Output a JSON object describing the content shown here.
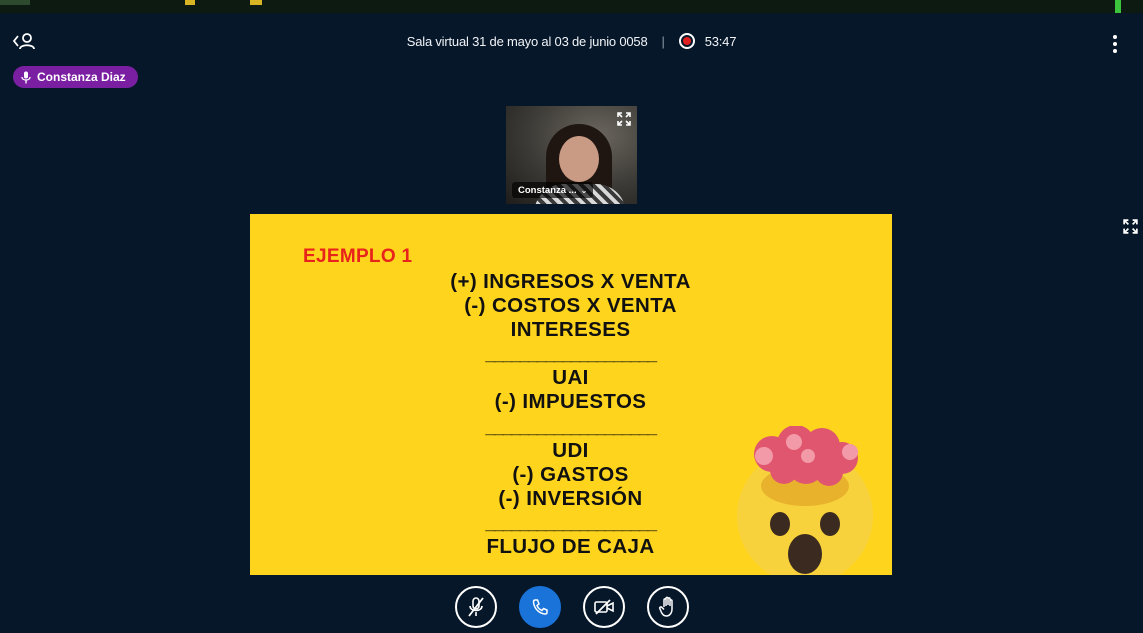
{
  "header": {
    "meeting_title": "Sala virtual 31 de mayo al 03 de junio 0058",
    "separator": "|",
    "recording_time": "53:47"
  },
  "talker": {
    "name": "Constanza Diaz"
  },
  "webcam": {
    "name": "Constanza ..."
  },
  "slide": {
    "title": "EJEMPLO 1",
    "lines": [
      "(+) INGRESOS X VENTA",
      "(-) COSTOS X VENTA",
      "INTERESES",
      "____________________",
      "UAI",
      "(-) IMPUESTOS",
      "____________________",
      "UDI",
      "(-) GASTOS",
      "(-) INVERSIÓN",
      "____________________",
      "FLUJO DE CAJA"
    ]
  },
  "icons": {
    "users": "user-list-icon",
    "record": "record-icon",
    "options": "more-vertical-icon",
    "expand": "expand-icon",
    "mute": "microphone-muted-icon",
    "leave_audio": "phone-icon",
    "camera": "camera-off-icon",
    "hand": "raise-hand-icon",
    "emoji": "exploding-head-emoji"
  },
  "colors": {
    "background": "#06172a",
    "slide": "#ffd41d",
    "talker": "#7b1fa2",
    "primary": "#1a73d9",
    "record": "#e02020",
    "title_red": "#e8231b"
  }
}
